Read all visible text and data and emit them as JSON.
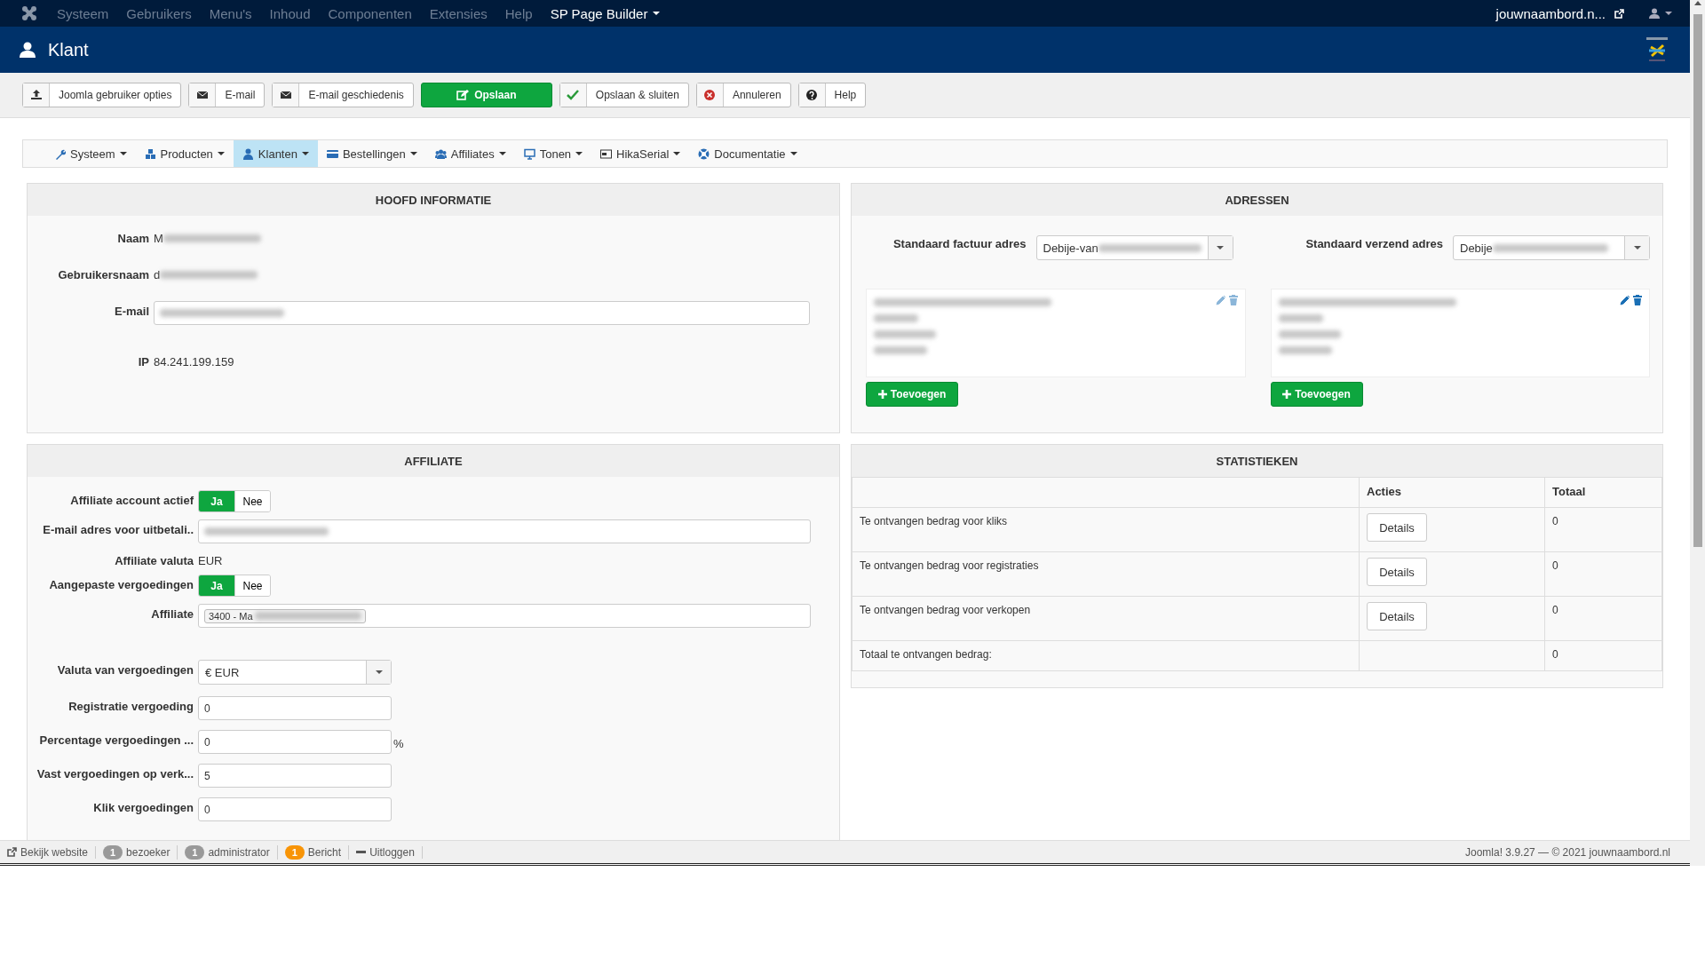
{
  "top_menu": {
    "items": [
      {
        "label": "Systeem",
        "kind": "plain"
      },
      {
        "label": "Gebruikers",
        "kind": "plain"
      },
      {
        "label": "Menu's",
        "kind": "plain"
      },
      {
        "label": "Inhoud",
        "kind": "plain"
      },
      {
        "label": "Componenten",
        "kind": "plain"
      },
      {
        "label": "Extensies",
        "kind": "plain"
      },
      {
        "label": "Help",
        "kind": "plain"
      },
      {
        "label": "SP Page Builder",
        "kind": "dropdown"
      }
    ],
    "site_link": "jouwnaambord.n..."
  },
  "header": {
    "title": "Klant"
  },
  "toolbar": [
    {
      "label": "Joomla gebruiker opties",
      "primary": false
    },
    {
      "label": "E-mail",
      "primary": false
    },
    {
      "label": "E-mail geschiedenis",
      "primary": false
    },
    {
      "label": "Opslaan",
      "primary": true
    },
    {
      "label": "Opslaan & sluiten",
      "primary": false
    },
    {
      "label": "Annuleren",
      "primary": false
    },
    {
      "label": "Help",
      "primary": false
    }
  ],
  "submenu": [
    {
      "label": "Systeem",
      "selected": false
    },
    {
      "label": "Producten",
      "selected": false
    },
    {
      "label": "Klanten",
      "selected": true
    },
    {
      "label": "Bestellingen",
      "selected": false
    },
    {
      "label": "Affiliates",
      "selected": false
    },
    {
      "label": "Tonen",
      "selected": false
    },
    {
      "label": "HikaSerial",
      "selected": false
    },
    {
      "label": "Documentatie",
      "selected": false
    }
  ],
  "main_info": {
    "title": "HOOFD INFORMATIE",
    "fields": [
      {
        "label": "Naam",
        "kind": "text",
        "value": "M",
        "redacted": true
      },
      {
        "label": "Gebruikersnaam",
        "kind": "text",
        "value": "d",
        "redacted": true
      },
      {
        "label": "E-mail",
        "kind": "input",
        "redacted": true
      },
      {
        "label": "IP",
        "kind": "text",
        "value": "84.241.199.159"
      }
    ]
  },
  "addresses": {
    "title": "ADRESSEN",
    "columns": [
      {
        "label": "Standaard factuur adres",
        "value": "Debije-van",
        "redacted": true,
        "actions_dimmed": true,
        "add_button": "Toevoegen"
      },
      {
        "label": "Standaard verzend adres",
        "value": "Debije",
        "redacted": true,
        "actions_dimmed": false,
        "add_button": "Toevoegen"
      }
    ]
  },
  "affiliate": {
    "title": "AFFILIATE",
    "fields": [
      {
        "label": "Affiliate account actief",
        "kind": "toggle",
        "options": [
          {
            "label": "Ja",
            "selected": true
          },
          {
            "label": "Nee",
            "selected": false
          }
        ]
      },
      {
        "label": "E-mail adres voor uitbetali..",
        "kind": "wide_input",
        "redacted": true
      },
      {
        "label": "Affiliate valuta",
        "kind": "text",
        "value": "EUR"
      },
      {
        "label": "Aangepaste vergoedingen",
        "kind": "toggle",
        "options": [
          {
            "label": "Ja",
            "selected": true
          },
          {
            "label": "Nee",
            "selected": false
          }
        ]
      },
      {
        "label": "Affiliate",
        "kind": "tag_input",
        "value": "3400 - Ma",
        "redacted": true
      },
      {
        "label": "Valuta van vergoedingen",
        "kind": "select",
        "value": "€ EUR"
      },
      {
        "label": "Registratie vergoeding",
        "kind": "input",
        "value": "0"
      },
      {
        "label": "Percentage vergoedingen ...",
        "kind": "input",
        "value": "0",
        "suffix": "%"
      },
      {
        "label": "Vast vergoedingen op verk...",
        "kind": "input",
        "value": "5"
      },
      {
        "label": "Klik vergoedingen",
        "kind": "input",
        "value": "0"
      }
    ]
  },
  "statistics": {
    "title": "STATISTIEKEN",
    "columns": [
      "Acties",
      "Totaal"
    ],
    "rows": [
      {
        "label": "Te ontvangen bedrag voor kliks",
        "action": "Details",
        "total": "0"
      },
      {
        "label": "Te ontvangen bedrag voor registraties",
        "action": "Details",
        "total": "0"
      },
      {
        "label": "Te ontvangen bedrag voor verkopen",
        "action": "Details",
        "total": "0"
      },
      {
        "label": "Totaal te ontvangen bedrag:",
        "total": "0"
      }
    ]
  },
  "status_bar": {
    "items": [
      {
        "label": "Bekijk website",
        "kind": "link"
      },
      {
        "label": "bezoeker",
        "kind": "badge",
        "count": "1",
        "color": "#999999"
      },
      {
        "label": "administrator",
        "kind": "badge",
        "count": "1",
        "color": "#999999"
      },
      {
        "label": "Bericht",
        "kind": "badge",
        "count": "1",
        "color": "#f89406"
      },
      {
        "label": "Uitloggen",
        "kind": "logout"
      }
    ],
    "version": "Joomla! 3.9.27  —  © 2021 jouwnaambord.nl"
  }
}
